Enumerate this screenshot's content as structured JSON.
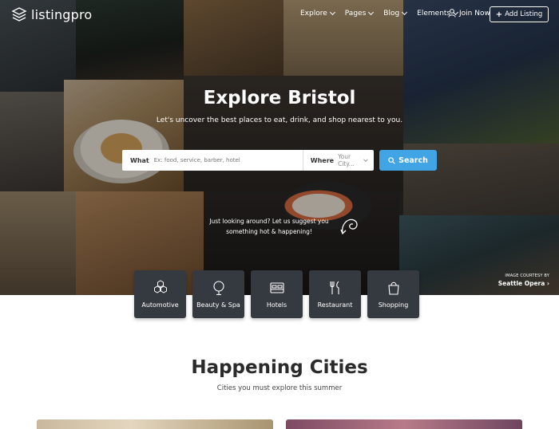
{
  "nav": {
    "logo_text": "listingpro",
    "menu": [
      {
        "label": "Explore"
      },
      {
        "label": "Pages"
      },
      {
        "label": "Blog"
      },
      {
        "label": "Elements"
      }
    ],
    "join_label": "Join Now",
    "add_listing_label": "Add Listing"
  },
  "hero": {
    "title": "Explore Bristol",
    "subtitle": "Let's uncover the best places to eat, drink, and shop nearest to you.",
    "suggest_text": "Just looking around? Let us suggest you something hot & happening!",
    "courtesy_label": "IMAGE COURTESY BY",
    "courtesy_link": "Seattle Opera ›"
  },
  "search": {
    "what_label": "What",
    "what_placeholder": "Ex: food, service, barber, hotel",
    "where_label": "Where",
    "where_value": "Your City...",
    "button_label": "Search"
  },
  "categories": [
    {
      "label": "Automotive",
      "icon": "hexagons-icon"
    },
    {
      "label": "Beauty & Spa",
      "icon": "mirror-icon"
    },
    {
      "label": "Hotels",
      "icon": "bed-icon"
    },
    {
      "label": "Restaurant",
      "icon": "cutlery-icon"
    },
    {
      "label": "Shopping",
      "icon": "shopping-bag-icon"
    }
  ],
  "section": {
    "title": "Happening Cities",
    "subtitle": "Cities you must explore this summer"
  },
  "colors": {
    "accent": "#41a4e4",
    "category_bg": "#353a40"
  }
}
